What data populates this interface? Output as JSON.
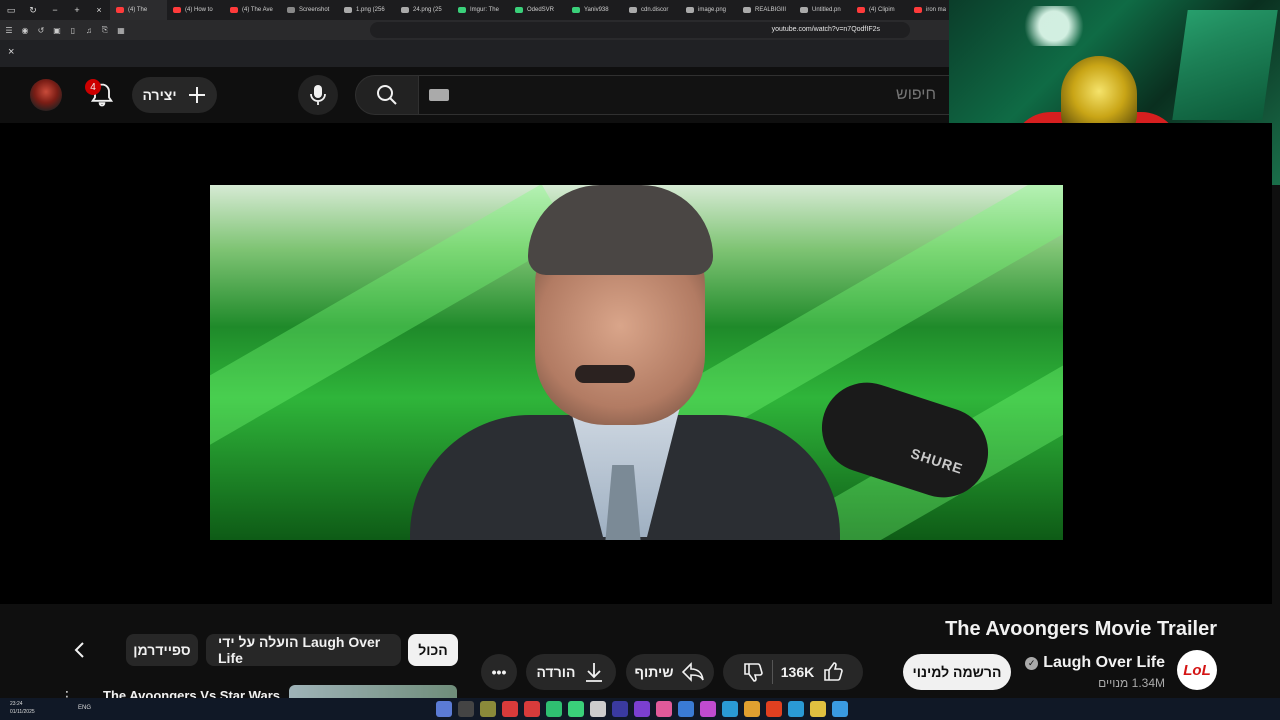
{
  "browser": {
    "tabs": [
      {
        "label": "(4) The",
        "color": "#ff3b3b",
        "active": true
      },
      {
        "label": "(4) How to",
        "color": "#ff3b3b"
      },
      {
        "label": "(4) The Ave",
        "color": "#ff3b3b"
      },
      {
        "label": "Screenshot",
        "color": "#888888"
      },
      {
        "label": "1.png (256",
        "color": "#aaaaaa"
      },
      {
        "label": "24.png (25",
        "color": "#aaaaaa"
      },
      {
        "label": "Imgur: The",
        "color": "#3ad07a"
      },
      {
        "label": "OdedSVR",
        "color": "#3ad07a"
      },
      {
        "label": "Yaniv938",
        "color": "#3ad07a"
      },
      {
        "label": "cdn.discor",
        "color": "#aaaaaa"
      },
      {
        "label": "image.png",
        "color": "#aaaaaa"
      },
      {
        "label": "REALBIGIII",
        "color": "#aaaaaa"
      },
      {
        "label": "Untitled.pn",
        "color": "#aaaaaa"
      },
      {
        "label": "(4) Clipim",
        "color": "#ff3b3b"
      },
      {
        "label": "iron ma",
        "color": "#ff3b3b"
      }
    ],
    "url": "youtube.com/watch?v=n7QodfIF2s",
    "close_glyph": "×"
  },
  "masthead": {
    "notification_count": "4",
    "create_label": "יצירה",
    "search_placeholder": "חיפוש"
  },
  "video": {
    "mic_brand": "SHURE"
  },
  "details": {
    "title": "The Avoongers Movie Trailer",
    "channel_name": "Laugh Over Life",
    "channel_logo": "LoL",
    "subscribers": "1.34M מנויים",
    "subscribe_label": "הרשמה למינוי",
    "likes": "136K",
    "share_label": "שיתוף",
    "download_label": "הורדה",
    "more_glyph": "•••"
  },
  "chips": {
    "all": "הכול",
    "uploaded_by": "הועלה על ידי Laugh Over Life",
    "spiderman": "ספיידרמן"
  },
  "recommendation": {
    "title": "The Avoongers Vs Star Wars"
  },
  "taskbar": {
    "time": "23:24",
    "date": "01/11/2025",
    "lang": "ENG",
    "icon_colors": [
      "#5b7bd5",
      "#444444",
      "#8a8a3a",
      "#d83b3b",
      "#d83b3b",
      "#2fbf71",
      "#3ad07a",
      "#cccccc",
      "#3a3aa0",
      "#7b3fd0",
      "#e05a9a",
      "#3a7bd5",
      "#c04bd0",
      "#2a9ad5",
      "#e0a030",
      "#e04020",
      "#2a9ad5",
      "#e0c040",
      "#3a9ae0"
    ]
  }
}
